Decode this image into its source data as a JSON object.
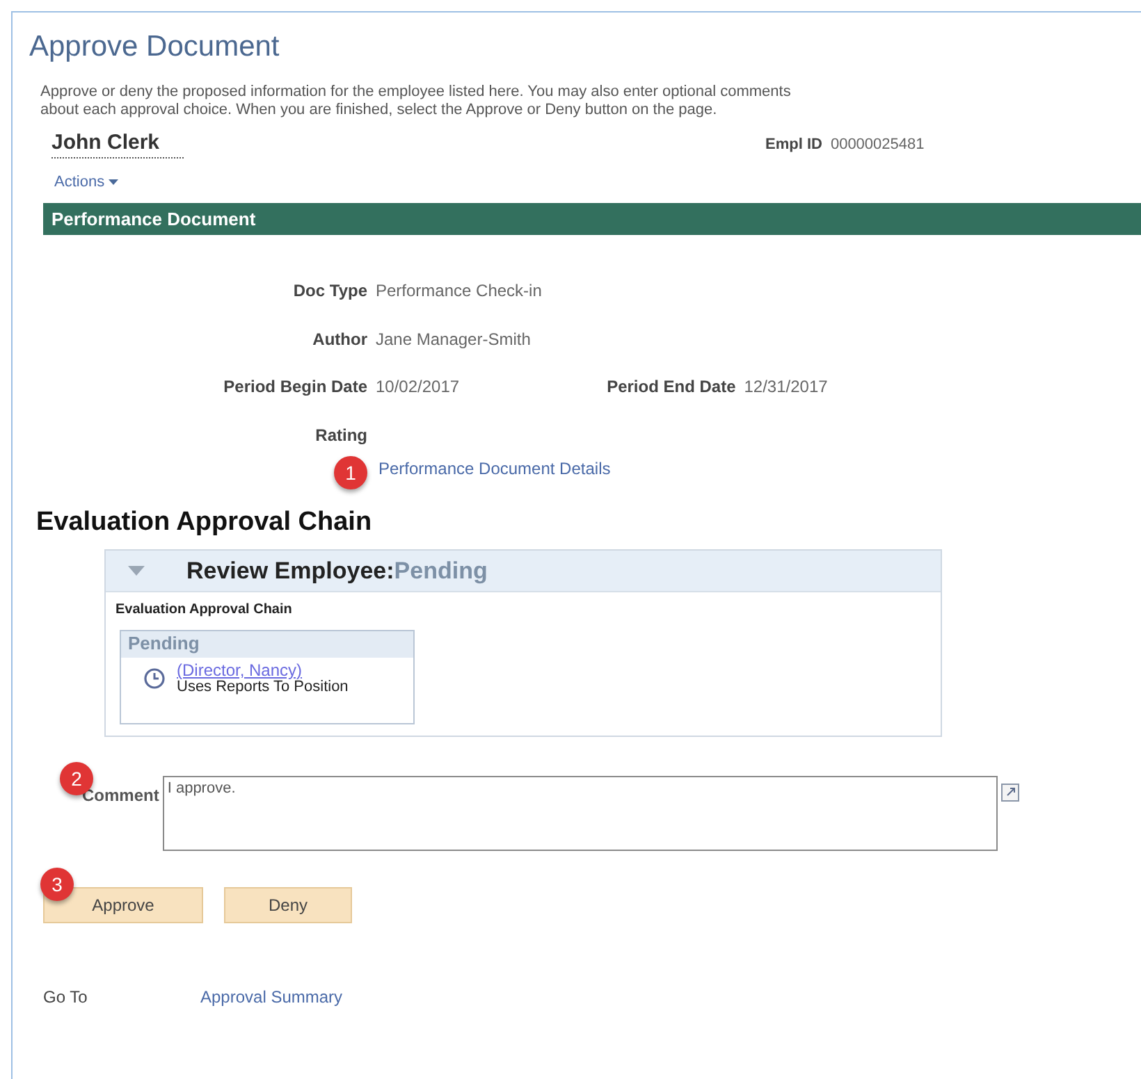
{
  "page": {
    "title": "Approve Document",
    "instructions": "Approve or deny the proposed information for the employee listed here. You may also enter optional comments about each approval choice. When you are finished, select the Approve or Deny button on the page."
  },
  "employee": {
    "name": "John Clerk",
    "empl_id_label": "Empl ID",
    "empl_id": "00000025481",
    "actions": "Actions"
  },
  "section": {
    "title": "Performance Document",
    "fields": [
      {
        "label": "Doc Type",
        "value": "Performance Check-in"
      },
      {
        "label": "Author",
        "value": "Jane Manager-Smith"
      },
      {
        "label": "Period Begin Date",
        "value": "10/02/2017",
        "label2": "Period End Date",
        "value2": "12/31/2017"
      },
      {
        "label": "Rating"
      }
    ],
    "details_link": "Performance Document Details"
  },
  "approval_chain": {
    "heading": "Evaluation Approval Chain",
    "step_title": "Review Employee:",
    "step_status": "Pending",
    "expanded": true,
    "chain_label": "Evaluation Approval Chain",
    "box_status": "Pending",
    "approver": "(Director, Nancy)",
    "approver_note": "Uses Reports To Position"
  },
  "comment": {
    "label": "Comment",
    "value": "I approve."
  },
  "buttons": [
    {
      "label": "Approve"
    },
    {
      "label": "Deny"
    }
  ],
  "goto": {
    "label": "Go To",
    "link": "Approval Summary"
  },
  "callouts": [
    "1",
    "2",
    "3"
  ]
}
